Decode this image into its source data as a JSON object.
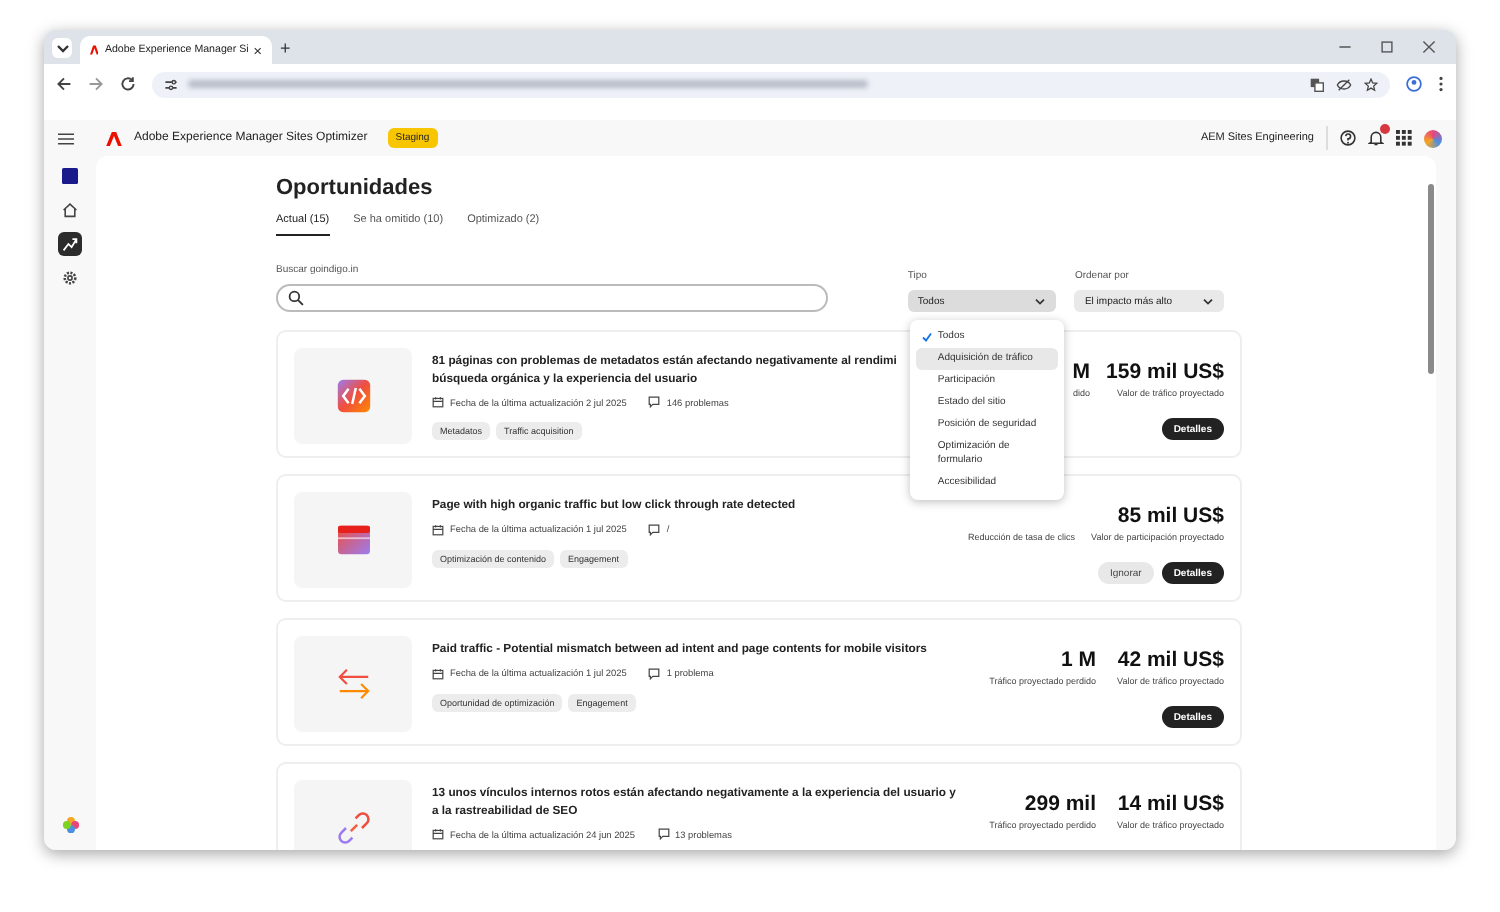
{
  "browser": {
    "tab_title": "Adobe Experience Manager Si",
    "new_tab": "+"
  },
  "header": {
    "product": "Adobe Experience Manager Sites Optimizer",
    "env_badge": "Staging",
    "org": "AEM Sites Engineering"
  },
  "nav_rail": [
    {
      "kind": "square",
      "selected": false
    },
    {
      "kind": "home",
      "selected": false
    },
    {
      "kind": "opportunities",
      "selected": true
    },
    {
      "kind": "settings",
      "selected": false
    }
  ],
  "page": {
    "title": "Oportunidades"
  },
  "tabs": [
    {
      "label": "Actual (15)",
      "selected": true
    },
    {
      "label": "Se ha omitido (10)",
      "selected": false
    },
    {
      "label": "Optimizado (2)",
      "selected": false
    }
  ],
  "search": {
    "label": "Buscar goindigo.in"
  },
  "filters": [
    {
      "label": "Tipo",
      "value": "Todos",
      "open": true
    },
    {
      "label": "Ordenar por",
      "value": "El impacto más alto",
      "open": false
    }
  ],
  "type_menu": [
    {
      "label": "Todos",
      "selected": true,
      "highlighted": false
    },
    {
      "label": "Adquisición de tráfico",
      "selected": false,
      "highlighted": true
    },
    {
      "label": "Participación",
      "selected": false,
      "highlighted": false
    },
    {
      "label": "Estado del sitio",
      "selected": false,
      "highlighted": false
    },
    {
      "label": "Posición de seguridad",
      "selected": false,
      "highlighted": false
    },
    {
      "label": "Optimización de formulario",
      "selected": false,
      "highlighted": false
    },
    {
      "label": "Accesibilidad",
      "selected": false,
      "highlighted": false
    }
  ],
  "cards": [
    {
      "title": "81 páginas con problemas de metadatos están afectando negativamente al rendimi búsqueda orgánica y la experiencia del usuario",
      "date": "Fecha de la última actualización 2 jul 2025",
      "issues": "146 problemas",
      "tags": [
        "Metadatos",
        "Traffic acquisition"
      ],
      "metrics": [
        {
          "value": "M",
          "label": "dido"
        },
        {
          "value": "159 mil US$",
          "label": "Valor de tráfico proyectado"
        }
      ],
      "buttons": [
        {
          "label": "Detalles",
          "kind": "primary"
        }
      ]
    },
    {
      "title": "Page with high organic traffic but low click through rate detected",
      "date": "Fecha de la última actualización 1 jul 2025",
      "issues": "/",
      "tags": [
        "Optimización de contenido",
        "Engagement"
      ],
      "metrics": [
        {
          "label": "Reducción de tasa de clics"
        },
        {
          "value": "85 mil US$",
          "label": "Valor de participación proyectado"
        }
      ],
      "buttons": [
        {
          "label": "Ignorar",
          "kind": "secondary"
        },
        {
          "label": "Detalles",
          "kind": "primary"
        }
      ]
    },
    {
      "title": "Paid traffic - Potential mismatch between ad intent and page contents for mobile visitors",
      "date": "Fecha de la última actualización 1 jul 2025",
      "issues": "1 problema",
      "tags": [
        "Oportunidad de optimización",
        "Engagement"
      ],
      "metrics": [
        {
          "value": "1 M",
          "label": "Tráfico proyectado perdido"
        },
        {
          "value": "42 mil US$",
          "label": "Valor de tráfico proyectado"
        }
      ],
      "buttons": [
        {
          "label": "Detalles",
          "kind": "primary"
        }
      ]
    },
    {
      "title": "13 unos vínculos internos rotos están afectando negativamente a la experiencia del usuario y a la rastreabilidad de SEO",
      "date": "Fecha de la última actualización 24 jun 2025",
      "issues": "13 problemas",
      "metrics": [
        {
          "value": "299 mil",
          "label": "Tráfico proyectado perdido"
        },
        {
          "value": "14 mil US$",
          "label": "Valor de tráfico proyectado"
        }
      ]
    }
  ]
}
